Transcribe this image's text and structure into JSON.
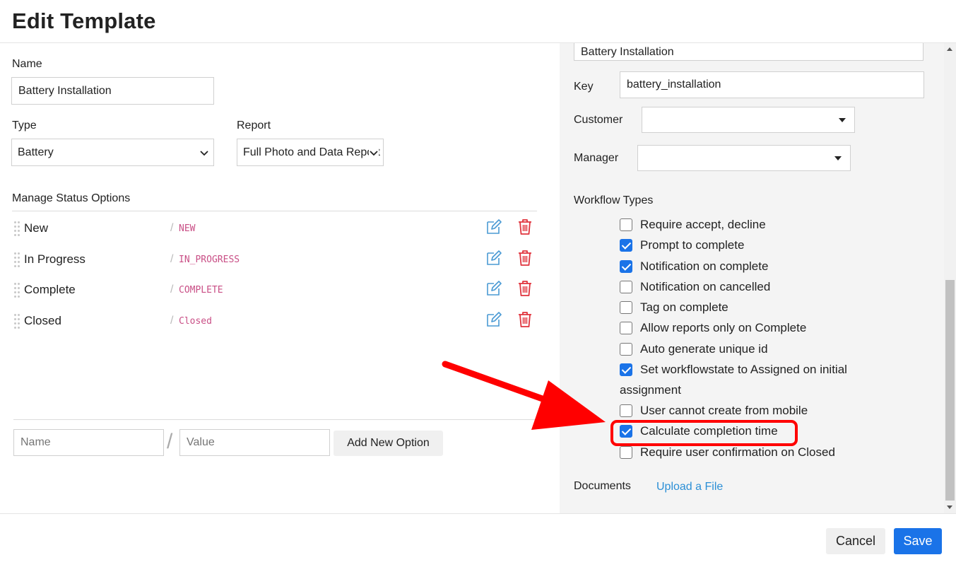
{
  "header": {
    "title": "Edit Template"
  },
  "left": {
    "name_label": "Name",
    "name_value": "Battery Installation",
    "type_label": "Type",
    "type_value": "Battery",
    "report_label": "Report",
    "report_value": "Full Photo and Data Report",
    "status_section_label": "Manage Status Options",
    "statuses": [
      {
        "name": "New",
        "value": "NEW"
      },
      {
        "name": "In Progress",
        "value": "IN_PROGRESS"
      },
      {
        "name": "Complete",
        "value": "COMPLETE"
      },
      {
        "name": "Closed",
        "value": "Closed"
      }
    ],
    "slash": "/",
    "new_option": {
      "name_placeholder": "Name",
      "value_placeholder": "Value",
      "separator": "/",
      "add_button": "Add New Option"
    }
  },
  "right": {
    "title_value": "Battery Installation",
    "key_label": "Key",
    "key_value": "battery_installation",
    "customer_label": "Customer",
    "customer_value": "",
    "manager_label": "Manager",
    "manager_value": "",
    "workflow_label": "Workflow Types",
    "workflow_items": [
      {
        "label": "Require accept, decline",
        "checked": false
      },
      {
        "label": "Prompt to complete",
        "checked": true
      },
      {
        "label": "Notification on complete",
        "checked": true
      },
      {
        "label": "Notification on cancelled",
        "checked": false
      },
      {
        "label": "Tag on complete",
        "checked": false
      },
      {
        "label": "Allow reports only on Complete",
        "checked": false
      },
      {
        "label": "Auto generate unique id",
        "checked": false
      },
      {
        "label": "Set workflowstate to Assigned on initial",
        "label_cont": "assignment",
        "checked": true
      },
      {
        "label": "User cannot create from mobile",
        "checked": false
      },
      {
        "label": "Calculate completion time",
        "checked": true,
        "highlighted": true
      },
      {
        "label": "Require user confirmation on Closed",
        "checked": false
      }
    ],
    "documents_label": "Documents",
    "upload_link": "Upload a File"
  },
  "footer": {
    "cancel": "Cancel",
    "save": "Save"
  },
  "colors": {
    "primary": "#1a73e8",
    "highlight": "#ff0000",
    "link": "#2b8fd6",
    "status_value": "#c94f86",
    "delete": "#e0333d",
    "edit": "#4a9ad4"
  }
}
